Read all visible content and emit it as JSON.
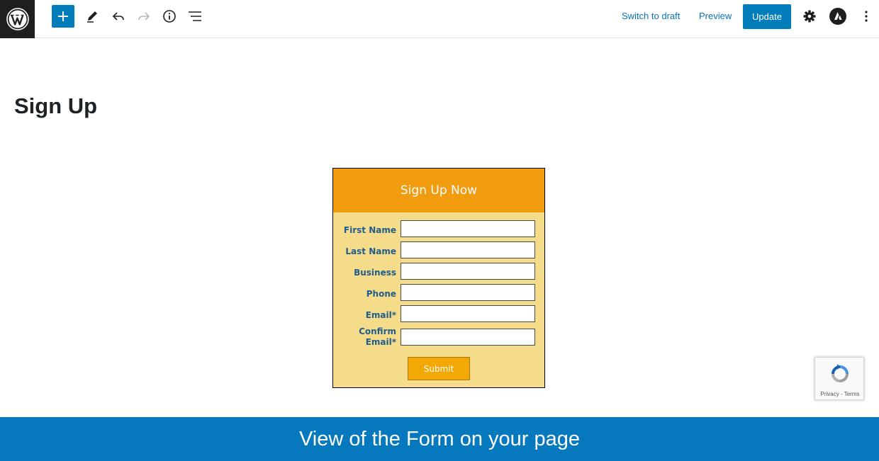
{
  "toolbar": {
    "logo_icon": "wordpress-logo-icon",
    "add_icon": "plus-icon",
    "edit_icon": "pencil-icon",
    "undo_icon": "undo-icon",
    "redo_icon": "redo-icon",
    "info_icon": "info-icon",
    "list_view_icon": "list-view-icon",
    "switch_to_draft_label": "Switch to draft",
    "preview_label": "Preview",
    "update_label": "Update",
    "settings_icon": "gear-icon",
    "astra_icon": "astra-logo-icon",
    "more_icon": "more-vertical-icon"
  },
  "page": {
    "title": "Sign Up"
  },
  "form": {
    "heading": "Sign Up Now",
    "fields": [
      {
        "label": "First Name",
        "value": ""
      },
      {
        "label": "Last Name",
        "value": ""
      },
      {
        "label": "Business",
        "value": ""
      },
      {
        "label": "Phone",
        "value": ""
      },
      {
        "label": "Email*",
        "value": ""
      },
      {
        "label_line1": "Confirm",
        "label_line2": "Email*",
        "value": ""
      }
    ],
    "submit_label": "Submit"
  },
  "recaptcha": {
    "privacy_label": "Privacy",
    "separator": " - ",
    "terms_label": "Terms"
  },
  "banner": {
    "text": "View of the Form on your page"
  },
  "colors": {
    "accent": "#007cba",
    "form_header": "#f19b0f",
    "form_body": "#f5dc8a",
    "label_text": "#1f5c8c",
    "submit": "#f4a806",
    "banner": "#0678be"
  }
}
